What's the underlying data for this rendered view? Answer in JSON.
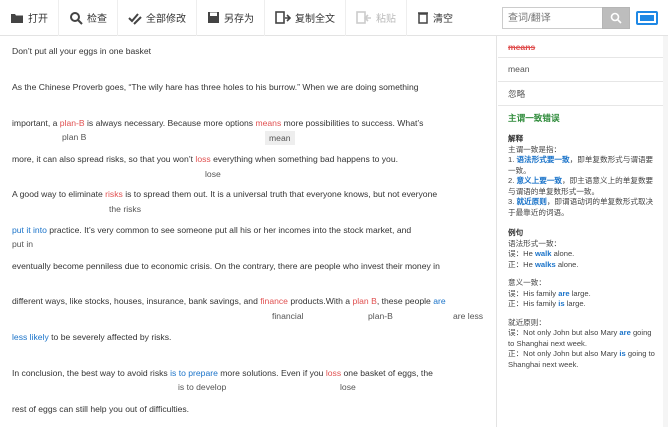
{
  "toolbar": {
    "open": "打开",
    "check": "检查",
    "fix_all": "全部修改",
    "save_as": "另存为",
    "copy_all": "复制全文",
    "paste": "粘贴",
    "clear": "清空",
    "search_placeholder": "查词/翻译"
  },
  "doc": {
    "l1": "Don’t put all your eggs in one basket",
    "l2": "As the Chinese Proverb goes, “The wily hare has three holes to his burrow.” When we are doing something",
    "l3a": "important, a ",
    "l3e1": "plan-B",
    "l3b": " is always necessary. Because more options ",
    "l3e2": "means",
    "l3c": " more possibilities to success. What’s",
    "s3a": "plan B",
    "s3b": "mean",
    "l4a": "more, it can also spread risks, so that you won’t ",
    "l4e": "loss",
    "l4b": " everything when something bad happens to you.",
    "s4": "lose",
    "l5a": "A good way to eliminate ",
    "l5e": "risks",
    "l5b": " is to spread them out. It is a universal truth that everyone knows, but not everyone",
    "s5": "the risks",
    "l6e": "put it into",
    "l6b": " practice. It’s very common to see someone put all his or her incomes into the stock market, and",
    "s6": "put in",
    "l7": "eventually become penniless due to economic crisis. On the contrary, there are people who invest their money in",
    "l8a": "different ways, like stocks, houses, insurance, bank savings, and ",
    "l8e1": "finance",
    "l8b": " products.With a ",
    "l8e2": "plan B",
    "l8c": ", these people ",
    "l8e3": "are",
    "s8a": "financial",
    "s8b": "plan-B",
    "s8c": "are less",
    "l9e": "less likely",
    "l9b": " to be severely affected by risks.",
    "l10a": "In conclusion, the best way to avoid risks ",
    "l10e1": "is to prepare",
    "l10b": " more solutions. Even if you ",
    "l10e2": "loss",
    "l10c": " one basket of eggs, the",
    "s10a": "is to develop",
    "s10b": "lose",
    "l11": "rest of eggs can still help you out of difficulties."
  },
  "panel": {
    "wrong": "means",
    "right": "mean",
    "ignore": "忽略",
    "rule_title": "主谓一致错误",
    "explain_title": "解释",
    "explain_intro": "主谓一致是指：",
    "e1_num": "1. ",
    "e1_key": "语法形式要一致",
    "e1_rest": "，即单复数形式与谓语要一致。",
    "e2_num": "2. ",
    "e2_key": "意义上要一致",
    "e2_rest": "，即主语意义上的单复数要与谓语的单复数形式一致。",
    "e3_num": "3. ",
    "e3_key": "就近原则",
    "e3_rest": "，即谓语动词的单复数形式取决于最靠近的词语。",
    "example_title": "例句",
    "ex1_title": "语法形式一致：",
    "ex1_w_pre": "误：He ",
    "ex1_w_key": "walk",
    "ex1_w_post": " alone.",
    "ex1_r_pre": "正：He ",
    "ex1_r_key": "walks",
    "ex1_r_post": " alone.",
    "ex2_title": "意义一致：",
    "ex2_w_pre": "误：His family ",
    "ex2_w_key": "are",
    "ex2_w_post": " large.",
    "ex2_r_pre": "正：His family ",
    "ex2_r_key": "is",
    "ex2_r_post": " large.",
    "ex3_title": "就近原则：",
    "ex3_w_pre": "误：Not only John but also Mary ",
    "ex3_w_key": "are",
    "ex3_w_post": " going to Shanghai next week.",
    "ex3_r_pre": "正：Not only John but also Mary ",
    "ex3_r_key": "is",
    "ex3_r_post": " going to Shanghai next week."
  },
  "colors": {
    "error": "#e05050",
    "link": "#1a73c9",
    "rule": "#2e8b3a"
  }
}
